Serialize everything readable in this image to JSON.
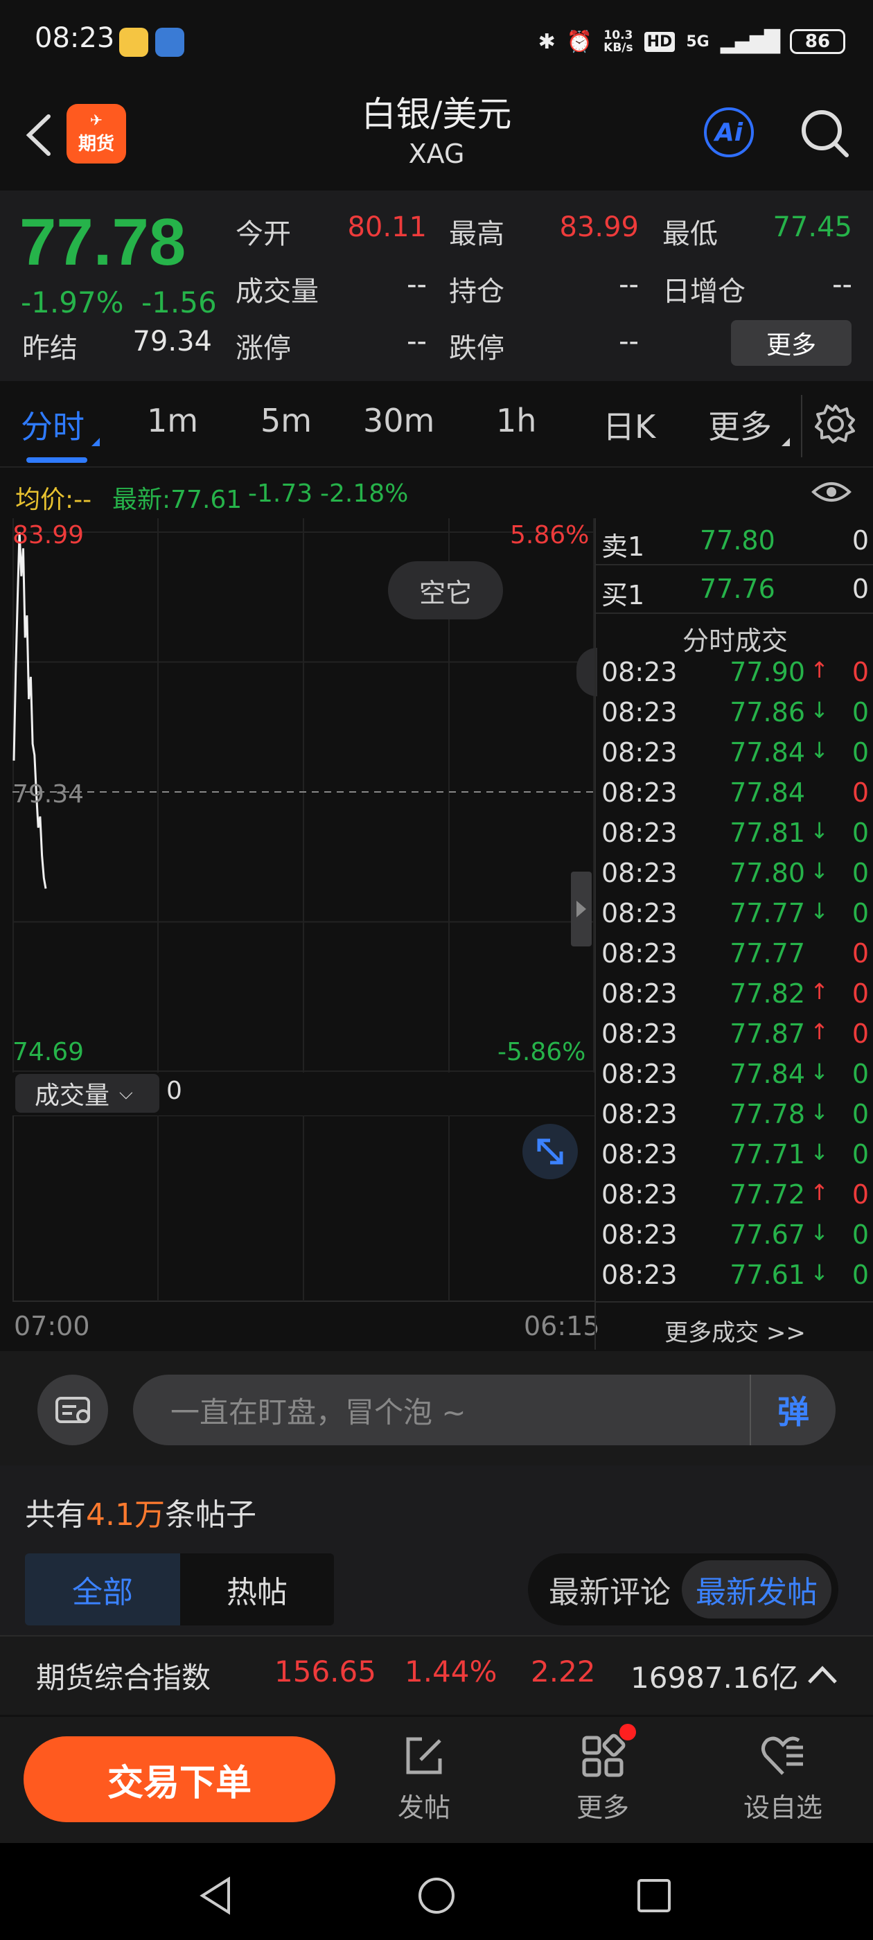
{
  "status_bar": {
    "time": "08:23",
    "net_speed_value": "10.3",
    "net_speed_unit": "KB/s",
    "hd": "HD",
    "signal": "5G",
    "battery": "86"
  },
  "header": {
    "title": "白银/美元",
    "subtitle": "XAG",
    "logo_text": "期货",
    "ai_label": "Ai"
  },
  "quote": {
    "price": "77.78",
    "change_pct": "-1.97%",
    "change": "-1.56",
    "prev_settle_label": "昨结",
    "prev_settle": "79.34",
    "open_label": "今开",
    "open": "80.11",
    "high_label": "最高",
    "high": "83.99",
    "low_label": "最低",
    "low": "77.45",
    "volume_label": "成交量",
    "volume": "--",
    "position_label": "持仓",
    "position": "--",
    "daily_add_label": "日增仓",
    "daily_add": "--",
    "limit_up_label": "涨停",
    "limit_up": "--",
    "limit_down_label": "跌停",
    "limit_down": "--",
    "more_label": "更多"
  },
  "tabs": [
    "分时",
    "1m",
    "5m",
    "30m",
    "1h",
    "日K",
    "更多"
  ],
  "info_line": {
    "avg": "均价:--",
    "latest": "最新:77.61",
    "change": "-1.73",
    "change_pct": "-2.18%"
  },
  "chart": {
    "top_price": "83.99",
    "top_pct": "5.86%",
    "mid_price": "79.34",
    "bottom_price": "74.69",
    "bottom_pct": "-5.86%",
    "badge": "空它",
    "time_start": "07:00",
    "time_end": "06:15",
    "volume_selector": "成交量",
    "volume_value": "0"
  },
  "chart_data": {
    "type": "line",
    "title": "",
    "xlabel": "",
    "ylabel": "",
    "ylim": [
      74.69,
      83.99
    ],
    "x_range": [
      "07:00",
      "06:15"
    ],
    "reference_line": 79.34,
    "series": [
      {
        "name": "",
        "values": [
          79.9,
          81.5,
          82.8,
          83.99,
          83.2,
          83.7,
          82.1,
          82.5,
          81.0,
          81.4,
          80.2,
          80.0,
          79.3,
          78.7,
          78.9,
          78.2,
          77.8,
          77.61
        ]
      }
    ]
  },
  "order_book": {
    "ask_label": "卖1",
    "ask_price": "77.80",
    "ask_vol": "0",
    "bid_label": "买1",
    "bid_price": "77.76",
    "bid_vol": "0"
  },
  "ticks_title": "分时成交",
  "ticks": [
    {
      "time": "08:23",
      "price": "77.90",
      "dir": "up",
      "vol": "0",
      "vol_color": "red"
    },
    {
      "time": "08:23",
      "price": "77.86",
      "dir": "down",
      "vol": "0",
      "vol_color": "green"
    },
    {
      "time": "08:23",
      "price": "77.84",
      "dir": "down",
      "vol": "0",
      "vol_color": "green"
    },
    {
      "time": "08:23",
      "price": "77.84",
      "dir": "none",
      "vol": "0",
      "vol_color": "red"
    },
    {
      "time": "08:23",
      "price": "77.81",
      "dir": "down",
      "vol": "0",
      "vol_color": "green"
    },
    {
      "time": "08:23",
      "price": "77.80",
      "dir": "down",
      "vol": "0",
      "vol_color": "green"
    },
    {
      "time": "08:23",
      "price": "77.77",
      "dir": "down",
      "vol": "0",
      "vol_color": "green"
    },
    {
      "time": "08:23",
      "price": "77.77",
      "dir": "none",
      "vol": "0",
      "vol_color": "red"
    },
    {
      "time": "08:23",
      "price": "77.82",
      "dir": "up",
      "vol": "0",
      "vol_color": "red"
    },
    {
      "time": "08:23",
      "price": "77.87",
      "dir": "up",
      "vol": "0",
      "vol_color": "red"
    },
    {
      "time": "08:23",
      "price": "77.84",
      "dir": "down",
      "vol": "0",
      "vol_color": "green"
    },
    {
      "time": "08:23",
      "price": "77.78",
      "dir": "down",
      "vol": "0",
      "vol_color": "green"
    },
    {
      "time": "08:23",
      "price": "77.71",
      "dir": "down",
      "vol": "0",
      "vol_color": "green"
    },
    {
      "time": "08:23",
      "price": "77.72",
      "dir": "up",
      "vol": "0",
      "vol_color": "red"
    },
    {
      "time": "08:23",
      "price": "77.67",
      "dir": "down",
      "vol": "0",
      "vol_color": "green"
    },
    {
      "time": "08:23",
      "price": "77.61",
      "dir": "down",
      "vol": "0",
      "vol_color": "green"
    }
  ],
  "more_ticks": "更多成交 >>",
  "comment": {
    "placeholder": "一直在盯盘，冒个泡 ~",
    "danmaku": "弹"
  },
  "posts": {
    "count_prefix": "共有",
    "count": "4.1万",
    "count_suffix": "条帖子",
    "tab_all": "全部",
    "tab_hot": "热帖",
    "sort_latest_comment": "最新评论",
    "sort_latest_post": "最新发帖"
  },
  "index_bar": {
    "name": "期货综合指数",
    "value": "156.65",
    "pct": "1.44%",
    "change": "2.22",
    "turnover": "16987.16亿"
  },
  "bottom_bar": {
    "trade": "交易下单",
    "post": "发帖",
    "more": "更多",
    "watch": "设自选"
  },
  "colors": {
    "up": "#ee3b3b",
    "down": "#26b34a",
    "accent": "#2f7bff",
    "brand": "#ff5a1f"
  }
}
